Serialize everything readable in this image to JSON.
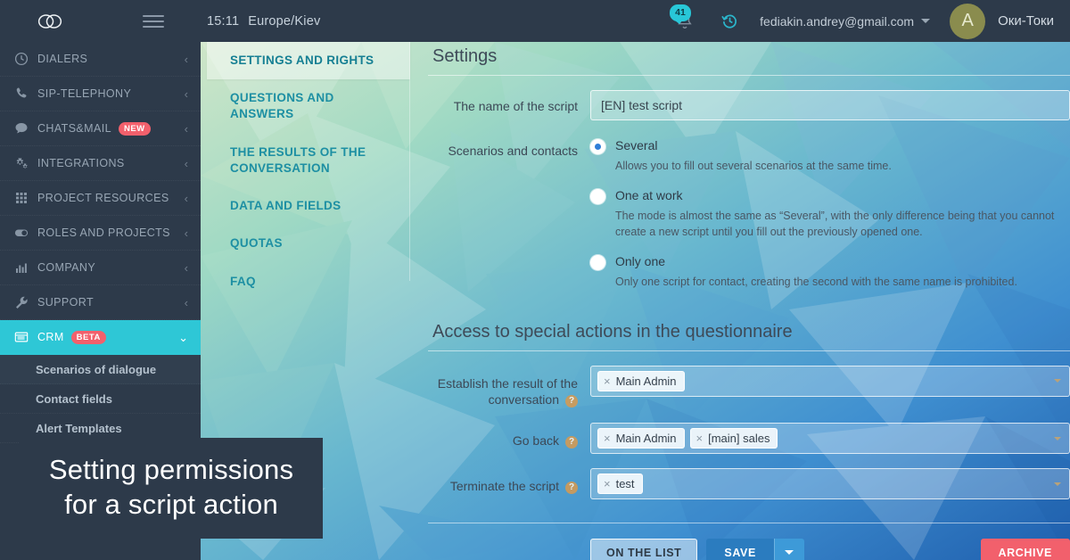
{
  "topbar": {
    "logo_icon": "cloud-logo-icon",
    "menu_icon": "hamburger-menu-icon",
    "time": "15:11",
    "timezone": "Europe/Kiev",
    "notifications_icon": "bell-icon",
    "notifications_count": "41",
    "history_icon": "history-clock-icon",
    "user_email": "fediakin.andrey@gmail.com",
    "user_caret_icon": "chevron-down-icon",
    "avatar_initial": "A",
    "brand_name": "Оки-Токи"
  },
  "sidebar": {
    "items": [
      {
        "label": "DIALERS",
        "icon": "clock-icon",
        "chevron": "‹",
        "badge": null,
        "active": false
      },
      {
        "label": "SIP-TELEPHONY",
        "icon": "phone-icon",
        "chevron": "‹",
        "badge": null,
        "active": false
      },
      {
        "label": "CHATS&MAIL",
        "icon": "chat-bubble-icon",
        "chevron": "‹",
        "badge": "NEW",
        "active": false
      },
      {
        "label": "INTEGRATIONS",
        "icon": "gears-icon",
        "chevron": "‹",
        "badge": null,
        "active": false
      },
      {
        "label": "PROJECT RESOURCES",
        "icon": "grid-icon",
        "chevron": "‹",
        "badge": null,
        "active": false
      },
      {
        "label": "ROLES AND PROJECTS",
        "icon": "toggle-icon",
        "chevron": "‹",
        "badge": null,
        "active": false
      },
      {
        "label": "COMPANY",
        "icon": "bar-chart-icon",
        "chevron": "‹",
        "badge": null,
        "active": false
      },
      {
        "label": "SUPPORT",
        "icon": "wrench-icon",
        "chevron": "‹",
        "badge": null,
        "active": false
      },
      {
        "label": "CRM",
        "icon": "crm-card-icon",
        "chevron": "⌄",
        "badge": "BETA",
        "active": true
      }
    ],
    "subitems": [
      {
        "label": "Scenarios of dialogue"
      },
      {
        "label": "Contact fields"
      },
      {
        "label": "Alert Templates"
      }
    ]
  },
  "tabs": [
    {
      "label": "SETTINGS AND RIGHTS",
      "active": true
    },
    {
      "label": "QUESTIONS AND ANSWERS",
      "active": false
    },
    {
      "label": "THE RESULTS OF THE CONVERSATION",
      "active": false
    },
    {
      "label": "DATA AND FIELDS",
      "active": false
    },
    {
      "label": "QUOTAS",
      "active": false
    },
    {
      "label": "FAQ",
      "active": false
    }
  ],
  "settings": {
    "title": "Settings",
    "script_name_label": "The name of the script",
    "script_name_value": "[EN] test script",
    "script_name_placeholder": "",
    "scenarios_label": "Scenarios and contacts",
    "options": [
      {
        "title": "Several",
        "description": "Allows you to fill out several scenarios at the same time.",
        "selected": true
      },
      {
        "title": "One at work",
        "description": "The mode is almost the same as “Several”, with the only difference being that you cannot create a new script until you fill out the previously opened one.",
        "selected": false
      },
      {
        "title": "Only one",
        "description": "Only one script for contact, creating the second with the same name is prohibited.",
        "selected": false
      }
    ]
  },
  "access": {
    "title": "Access to special actions in the questionnaire",
    "rows": [
      {
        "label": "Establish the result of the conversation",
        "help_icon": "help-question-icon",
        "chips": [
          "Main Admin"
        ],
        "remove_icon": "×"
      },
      {
        "label": "Go back",
        "help_icon": "help-question-icon",
        "chips": [
          "Main Admin",
          "[main] sales"
        ],
        "remove_icon": "×"
      },
      {
        "label": "Terminate the script",
        "help_icon": "help-question-icon",
        "chips": [
          "test"
        ],
        "remove_icon": "×"
      }
    ]
  },
  "buttons": {
    "on_the_list": "ON THE LIST",
    "save": "SAVE",
    "save_caret_icon": "chevron-down-icon",
    "archive": "ARCHIVE"
  },
  "caption": {
    "line1": "Setting permissions",
    "line2": "for a script action"
  },
  "colors": {
    "sidebar_bg": "#2d3a4a",
    "accent_cyan": "#2ec7d6",
    "badge_red": "#f2606c",
    "save_blue": "#2b7cbf",
    "tab_teal": "#1d8fa3",
    "avatar_olive": "#8a8c4e"
  }
}
